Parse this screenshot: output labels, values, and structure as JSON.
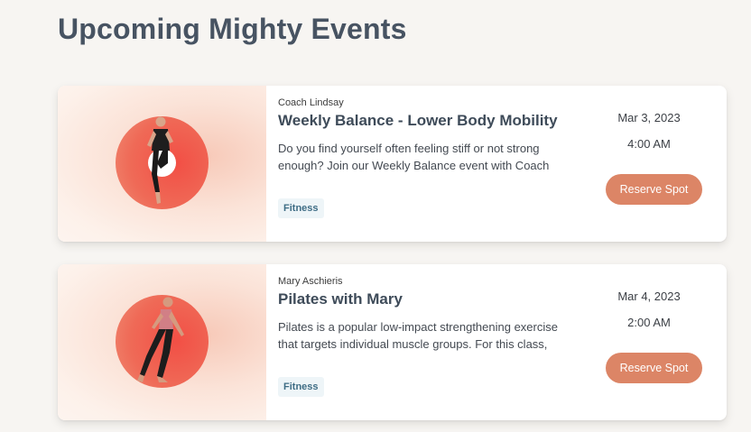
{
  "page": {
    "title": "Upcoming Mighty Events"
  },
  "events": [
    {
      "coach": "Coach Lindsay",
      "title": "Weekly Balance - Lower Body Mobility",
      "description": "Do you find yourself often feeling stiff or not strong enough? Join our Weekly Balance event with Coach",
      "tag": "Fitness",
      "date": "Mar 3, 2023",
      "time": "4:00 AM",
      "button_label": "Reserve Spot"
    },
    {
      "coach": "Mary Aschieris",
      "title": "Pilates with Mary",
      "description": "Pilates is a popular low-impact strengthening exercise that targets individual muscle groups. For this class, Mary will",
      "tag": "Fitness",
      "date": "Mar 4, 2023",
      "time": "2:00 AM",
      "button_label": "Reserve Spot"
    }
  ],
  "colors": {
    "background": "#f7f5f2",
    "button": "#dc8566",
    "circle": "#f24f45",
    "tag_bg": "#eef5f8"
  }
}
